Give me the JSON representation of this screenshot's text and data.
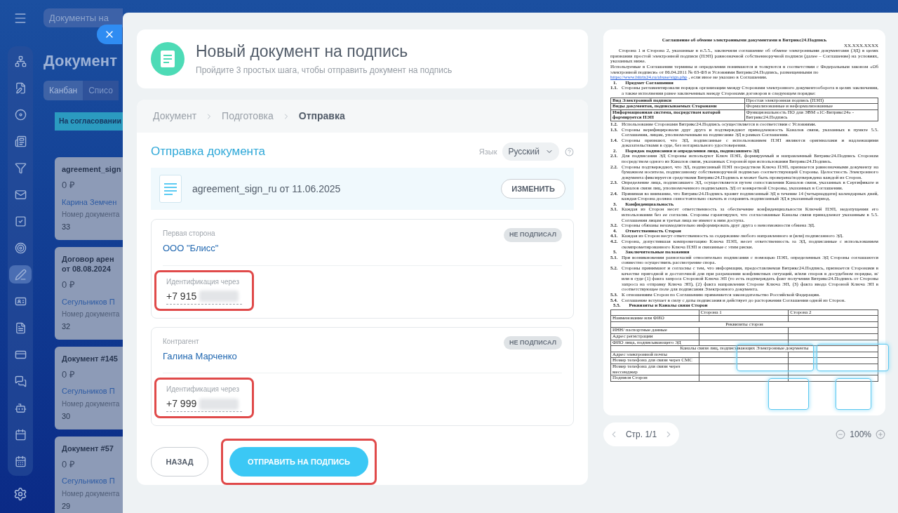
{
  "background": {
    "search": {
      "placeholder": "Документы на"
    },
    "title": "Документ",
    "tabs": [
      {
        "label": "Канбан",
        "selected": true
      },
      {
        "label": "Списо",
        "selected": false
      }
    ],
    "column": "На согласовании",
    "cards": [
      {
        "title": [
          "agreement_sign"
        ],
        "amount": "0 ₽",
        "person": "Карина Земчен",
        "field": "Номер документа",
        "number": "33"
      },
      {
        "title": [
          "Договор арен",
          "от 08.08.2024"
        ],
        "amount": "0 ₽",
        "person": "Сегульников П",
        "field": "Номер документа",
        "number": "32"
      },
      {
        "title": [
          "Документ #145"
        ],
        "amount": "0 ₽",
        "person": "Сегульников П",
        "field": "Номер документа",
        "number": "30"
      },
      {
        "title": [
          "Документ #57"
        ],
        "amount": "0 ₽",
        "person": "Сегульников П",
        "field": "Номер документа",
        "number": "29"
      }
    ]
  },
  "nav_rail": [
    {
      "selected": false
    },
    {
      "selected": false
    },
    {
      "selected": false
    },
    {
      "selected": false
    },
    {
      "selected": false
    },
    {
      "selected": false
    },
    {
      "selected": false
    },
    {
      "selected": false
    },
    {
      "selected": true
    },
    {
      "selected": false
    },
    {
      "selected": false
    },
    {
      "selected": false
    },
    {
      "selected": false
    },
    {
      "selected": false
    },
    {
      "selected": false
    },
    {
      "selected": false
    }
  ],
  "header": {
    "title": "Новый документ на подпись",
    "subtitle": "Пройдите 3 простых шага, чтобы отправить документ на подпись"
  },
  "steps": [
    {
      "label": "Документ",
      "selected": false
    },
    {
      "label": "Подготовка",
      "selected": false
    },
    {
      "label": "Отправка",
      "selected": true
    }
  ],
  "section_title": "Отправка документа",
  "language": {
    "label": "Язык",
    "value": "Русский"
  },
  "file": {
    "name": "agreement_sign_ru от 11.06.2025",
    "button": "ИЗМЕНИТЬ"
  },
  "parties": [
    {
      "role": "Первая сторона",
      "name": "ООО \"Блисс\"",
      "status": "НЕ ПОДПИСАЛ",
      "id_label": "Идентификация через",
      "phone": "+7 915",
      "highlighted": true
    },
    {
      "role": "Контрагент",
      "name": "Галина Марченко",
      "status": "НЕ ПОДПИСАЛ",
      "id_label": "Идентификация через",
      "phone": "+7 999",
      "highlighted": true
    }
  ],
  "back_button": "НАЗАД",
  "send_button": {
    "label": "ОТПРАВИТЬ НА ПОДПИСЬ",
    "highlighted": true
  },
  "document": [
    {
      "kind": "title",
      "text": "Соглашение об обмене электронными документами в Битрикс24.Подпись"
    },
    {
      "kind": "date",
      "text": "XX.XXX.XXXX"
    },
    {
      "kind": "para",
      "text": "Сторона 1 и Сторона 2, указанные в п.5.5., заключили соглашение об обмене электронными документами (ЭД) в целях признания простой электронной подписи (ПЭП) равнозначной собственноручной подписи (далее – Соглашение) на условиях, указанных ниже."
    },
    {
      "kind": "link_para",
      "before": "Используемые в Соглашении термины и определения понимаются и толкуются в соответствии с Федеральным законом «Об электронной подписи» от 06.04.2011 № 63-ФЗ и Условиями Битрикс24.Подпись, размещенными по",
      "link": "https://www.bitrix24.ru/abuse/sign.php",
      "after": ", если иное не указано в Соглашении."
    },
    {
      "kind": "heading",
      "number": "1.",
      "text": "Предмет Соглашения"
    },
    {
      "kind": "clause",
      "number": "1.1.",
      "text": "Стороны регламентировали порядок организации между Сторонами электронного документооборота в целях заключения, а также исполнения ранее заключенных между Сторонами договоров в следующем порядке:"
    },
    {
      "kind": "table",
      "rows": [
        [
          "Вид Электронной подписи",
          "Простая электронная подпись (ПЭП)"
        ],
        [
          "Виды документов, подписываемых Сторонами",
          "Формализованные и неформализованные"
        ],
        [
          "Информационная система, посредством которой формируется ПЭП",
          "Функциональность ПО для ЭВМ «1С-Битрикс24» - Битрикс24.Подпись"
        ]
      ]
    },
    {
      "kind": "clause",
      "number": "1.2.",
      "text": "Использование Сторонами Битрикс24.Подпись осуществляется в соответствии с Условиями."
    },
    {
      "kind": "clause",
      "number": "1.3.",
      "text": "Стороны верифицировали друг друга и подтверждают принадлежность Каналов связи, указанных в пункте 5.5. Соглашения, лицам, уполномоченным на подписание ЭД в рамках Соглашения."
    },
    {
      "kind": "clause",
      "number": "1.4.",
      "text": "Стороны признают, что ЭД, подписанные с использованием ПЭП являются оригиналами и надлежащими доказательствами в суде, без нотариального удостоверения."
    },
    {
      "kind": "heading",
      "number": "2.",
      "text": "Порядок подписания и определения лица, подписавшего ЭД"
    },
    {
      "kind": "clause",
      "number": "2.1.",
      "text": "Для подписания ЭД Стороны используют Ключ ПЭП, формируемый и направленный Битрикс24.Подпись Сторонам посредством одного из Каналов связи, указанных Стороной при использовании Битрикс24.Подпись."
    },
    {
      "kind": "clause",
      "number": "2.2.",
      "text": "Стороны подтверждают, что ЭД, подписанный ПЭП посредством Ключа ПЭП, признается равнозначными документу на бумажном носителе, подписанному собственноручной подписью соответствующей Стороны. Целостность Электронного документа фиксируется средствами Битрикс24.Подпись и может быть проверена/подтверждена каждой из Сторон."
    },
    {
      "kind": "clause",
      "number": "2.3.",
      "text": "Определение лица, подписавшего ЭД, осуществляется путем сопоставления Каналов связи, указанных в Сертификате и Каналов связи лиц, уполномоченного подписывать ЭД от конкретной Стороны, указанных в Соглашении."
    },
    {
      "kind": "clause",
      "number": "2.4.",
      "text": "Принимая во внимание, что Битрикс24.Подпись хранит подписанный ЭД в течение 14 (четырнадцати) календарных дней, каждая Сторона должна самостоятельно скачать и сохранить подписанный ЭД в указанный период."
    },
    {
      "kind": "heading",
      "number": "3.",
      "text": "Конфиденциальность"
    },
    {
      "kind": "clause",
      "number": "3.1.",
      "text": "Каждая из Сторон несет ответственность за обеспечение конфиденциальности Ключей ПЭП, недопущения его использования без ее согласия. Стороны гарантируют, что согласованные Каналы связи принадлежат указанным в 5.5. Соглашения лицам и третьи лица не имеют к ним доступа."
    },
    {
      "kind": "clause",
      "number": "3.2.",
      "text": "Стороны обязаны незамедлительно информировать друг друга о невозможности обмена ЭД."
    },
    {
      "kind": "heading",
      "number": "4.",
      "text": "Ответственность Сторон"
    },
    {
      "kind": "clause",
      "number": "4.1.",
      "text": "Каждая из Сторон несут ответственность за содержание любого направленного и (или) подписанного ЭД."
    },
    {
      "kind": "clause",
      "number": "4.2.",
      "text": "Сторона, допустившая компрометацию Ключа ПЭП, несет ответственность за ЭД, подписанные с использованием скомпрометированного Ключа ПЭП и связанные с этим риски."
    },
    {
      "kind": "heading",
      "number": "5.",
      "text": "Заключительные положения"
    },
    {
      "kind": "clause",
      "number": "5.1.",
      "text": "При возникновении разногласий относительно подписания с помощью ПЭП, определенных ЭД Стороны соглашаются совместно осуществить рассмотрение спора."
    },
    {
      "kind": "clause",
      "number": "5.2.",
      "text": "Стороны принимают и согласны с тем, что информация, предоставляемая Битрикс24.Подпись, признается Сторонами в качестве пригодной и достаточной для при разрешении конфликтных ситуаций, и/или споров в досудебном порядке, и/или в суде (1) факта запроса Стороной Ключа ЭП (то есть подтверждать факт получения Битрикс24.Подпись от Стороны запроса на отправку Ключа ЭП), (2) факта направления Стороне Ключа ЭП, (3) факта ввода Стороной Ключа ЭП в соответствующее поле для подписания Электронного документа."
    },
    {
      "kind": "clause",
      "number": "5.3.",
      "text": "К отношениям Сторон по Соглашению применяется законодательство Российской Федерации."
    },
    {
      "kind": "clause",
      "number": "5.4.",
      "text": "Соглашение вступает в силу с даты подписания и действует до расторжения Соглашения одной из Сторон."
    },
    {
      "kind": "heading",
      "number": "5.5.",
      "text": "Реквизиты и Каналы связи Сторон"
    },
    {
      "kind": "requisites",
      "header": [
        "Сторона 1",
        "Сторона 2"
      ],
      "rows": [
        {
          "kind": "row",
          "label": "Наименование или ФИО"
        },
        {
          "kind": "span",
          "label": "Реквизиты сторон"
        },
        {
          "kind": "row",
          "label": "ИНН/ паспортные данные"
        },
        {
          "kind": "row",
          "label": "Адрес регистрации"
        },
        {
          "kind": "row",
          "label": "ФИО лица, подписывающего ЭД"
        },
        {
          "kind": "span",
          "label": "Каналы связи лиц, подписывающих Электронные документы"
        },
        {
          "kind": "row",
          "label": "Адрес электронной почты"
        },
        {
          "kind": "row",
          "label": "Номер телефона для связи через СМС"
        },
        {
          "kind": "row",
          "label": "Номер телефона для связи через мессенджер"
        },
        {
          "kind": "row",
          "label": "Подписи Сторон"
        }
      ]
    }
  ],
  "pager": {
    "page": "Стр. 1/1",
    "zoom": "100%"
  }
}
